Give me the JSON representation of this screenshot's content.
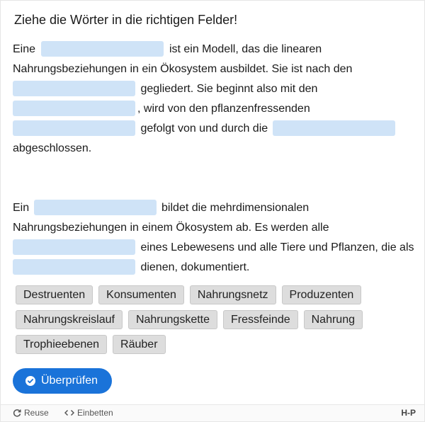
{
  "title": "Ziehe die Wörter in die richtigen Felder!",
  "paragraph1": {
    "t1": "Eine",
    "t2": "ist ein Modell, das die linearen Nahrungsbeziehungen in ein Ökosystem ausbildet. Sie ist nach den",
    "t3": "gegliedert. Sie beginnt also mit den",
    "t4": ", wird von den pflanzenfressenden",
    "t5": "gefolgt von und durch die",
    "t6": "abgeschlossen."
  },
  "paragraph2": {
    "t1": "Ein",
    "t2": "bildet die mehrdimensionalen Nahrungsbeziehungen in einem Ökosystem ab. Es werden alle",
    "t3": "eines Lebewesens und alle Tiere und Pflanzen, die als",
    "t4": "dienen, dokumentiert."
  },
  "words": [
    "Destruenten",
    "Konsumenten",
    "Nahrungsnetz",
    "Produzenten",
    "Nahrungskreislauf",
    "Nahrungskette",
    "Fressfeinde",
    "Nahrung",
    "Trophieebenen",
    "Räuber"
  ],
  "check_button": "Überprüfen",
  "footer": {
    "reuse": "Reuse",
    "embed": "Einbetten",
    "logo": "H-P"
  },
  "colors": {
    "accent": "#1a73d9",
    "gap": "#cfe3f7"
  }
}
